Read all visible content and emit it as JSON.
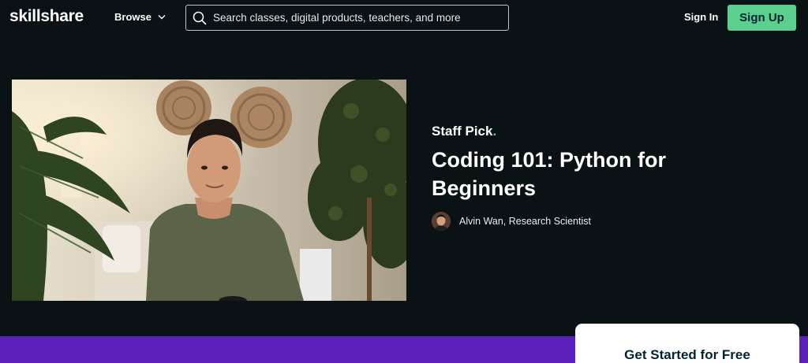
{
  "header": {
    "logo": "skillshare",
    "browse_label": "Browse",
    "search_placeholder": "Search classes, digital products, teachers, and more",
    "signin_label": "Sign In",
    "signup_label": "Sign Up"
  },
  "hero": {
    "badge": "Staff Pick",
    "badge_dot": ".",
    "title": "Coding 101: Python for Beginners",
    "teacher": "Alvin Wan, Research Scientist"
  },
  "cta": {
    "title": "Get Started for Free"
  },
  "colors": {
    "background": "#0a1215",
    "accent_green": "#5bd08e",
    "band_purple": "#5c21bd"
  }
}
